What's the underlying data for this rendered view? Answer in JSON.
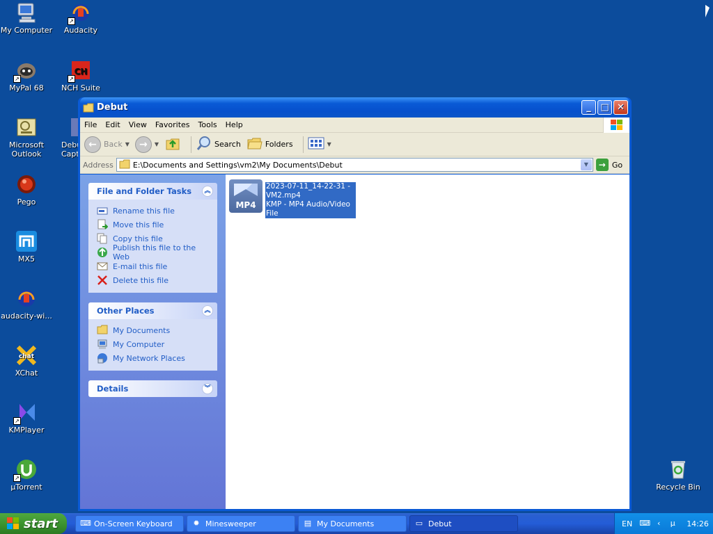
{
  "desktop": {
    "icons": [
      {
        "label": "My Computer",
        "icon": "my-computer-icon"
      },
      {
        "label": "Audacity",
        "icon": "audacity-icon"
      },
      {
        "label": "MyPal 68",
        "icon": "mypal-icon"
      },
      {
        "label": "NCH Suite",
        "icon": "nch-suite-icon"
      },
      {
        "label": "Microsoft Outlook",
        "icon": "outlook-icon"
      },
      {
        "label": "Debut Capt",
        "icon": "debut-icon"
      },
      {
        "label": "Pego",
        "icon": "pego-icon"
      },
      {
        "label": "MX5",
        "icon": "mx5-icon"
      },
      {
        "label": "audacity-wi...",
        "icon": "audacity-installer-icon"
      },
      {
        "label": "XChat",
        "icon": "xchat-icon"
      },
      {
        "label": "KMPlayer",
        "icon": "kmplayer-icon"
      },
      {
        "label": "µTorrent",
        "icon": "utorrent-icon"
      },
      {
        "label": "Recycle Bin",
        "icon": "recycle-bin-icon"
      }
    ]
  },
  "window": {
    "title": "Debut",
    "menu": [
      "File",
      "Edit",
      "View",
      "Favorites",
      "Tools",
      "Help"
    ],
    "toolbar": {
      "back": "Back",
      "search": "Search",
      "folders": "Folders"
    },
    "address": {
      "label": "Address",
      "value": "E:\\Documents and Settings\\vm2\\My Documents\\Debut",
      "go": "Go"
    },
    "file_folder_tasks": {
      "title": "File and Folder Tasks",
      "items": [
        "Rename this file",
        "Move this file",
        "Copy this file",
        "Publish this file to the Web",
        "E-mail this file",
        "Delete this file"
      ]
    },
    "other_places": {
      "title": "Other Places",
      "items": [
        "My Documents",
        "My Computer",
        "My Network Places"
      ]
    },
    "details": {
      "title": "Details"
    },
    "file": {
      "icon_label": "MP4",
      "name_line1": "2023-07-11_14-22-31 -",
      "name_line2": "VM2.mp4",
      "type": "KMP - MP4 Audio/Video File"
    }
  },
  "taskbar": {
    "start": "start",
    "tasks": [
      "On-Screen Keyboard",
      "Minesweeper",
      "My Documents",
      "Debut"
    ],
    "lang": "EN",
    "clock": "14:26"
  },
  "colors": {
    "desktop": "#0c4c9c",
    "title_blue": "#0a5ad6",
    "task_link": "#215dc6",
    "selection": "#316ac5"
  }
}
